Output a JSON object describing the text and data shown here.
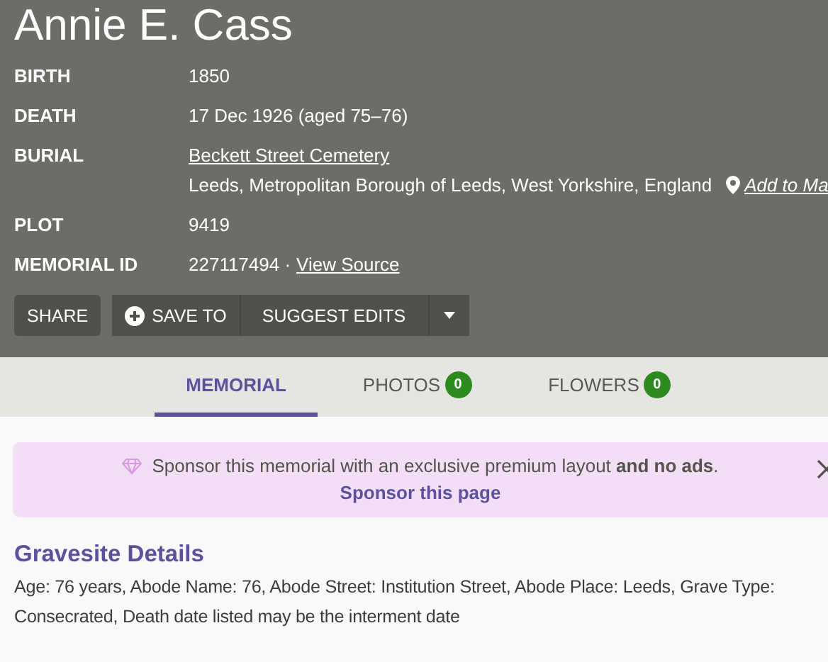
{
  "person": {
    "name": "Annie E. Cass"
  },
  "facts": [
    {
      "label": "BIRTH",
      "value": "1850"
    },
    {
      "label": "DEATH",
      "value": "17 Dec 1926 (aged 75–76)"
    },
    {
      "label": "BURIAL",
      "link": "Beckett Street Cemetery",
      "location": "Leeds, Metropolitan Borough of Leeds, West Yorkshire, England",
      "map_link": "Add to Ma"
    },
    {
      "label": "PLOT",
      "value": "9419"
    },
    {
      "label": "MEMORIAL ID",
      "value": "227117494 ·",
      "link": "View Source"
    }
  ],
  "actions": [
    {
      "kind": "share",
      "label": "SHARE"
    },
    {
      "kind": "save",
      "label": "SAVE TO"
    },
    {
      "kind": "suggest",
      "label": "SUGGEST EDITS"
    },
    {
      "kind": "menu"
    }
  ],
  "tabs": [
    {
      "label": "MEMORIAL",
      "selected": true
    },
    {
      "label": "PHOTOS",
      "count": "0",
      "selected": false
    },
    {
      "label": "FLOWERS",
      "count": "0",
      "selected": false
    }
  ],
  "sponsor": {
    "message": "Sponsor this memorial with an exclusive premium layout **and no ads**.",
    "link": "Sponsor this page"
  },
  "gravesite": {
    "title": "Gravesite Details",
    "text": "Age: 76 years, Abode Name: 76, Abode Street: Institution Street, Abode Place: Leeds, Grave Type: Consecrated, Death date listed may be the interment date"
  }
}
